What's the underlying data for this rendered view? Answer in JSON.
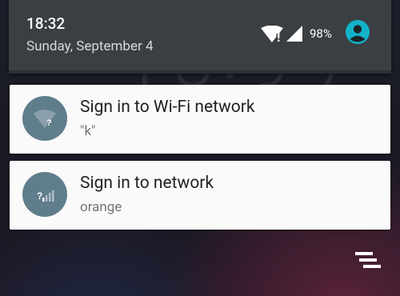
{
  "status": {
    "time": "18:32",
    "date": "Sunday, September 4",
    "battery": "98%"
  },
  "notifications": [
    {
      "icon": "wifi-question-icon",
      "title": "Sign in to Wi-Fi network",
      "subtitle": "\"k\""
    },
    {
      "icon": "cellular-question-icon",
      "title": "Sign in to network",
      "subtitle": "orange"
    }
  ],
  "colors": {
    "header_bg": "#3a3f44",
    "card_bg": "#fafafa",
    "icon_circle": "#607d8b",
    "avatar": "#12b3c8"
  },
  "icons": {
    "wifi": "wifi-question-icon",
    "signal": "cell-signal-icon",
    "avatar": "user-avatar-icon",
    "clear_all": "clear-all-icon"
  }
}
